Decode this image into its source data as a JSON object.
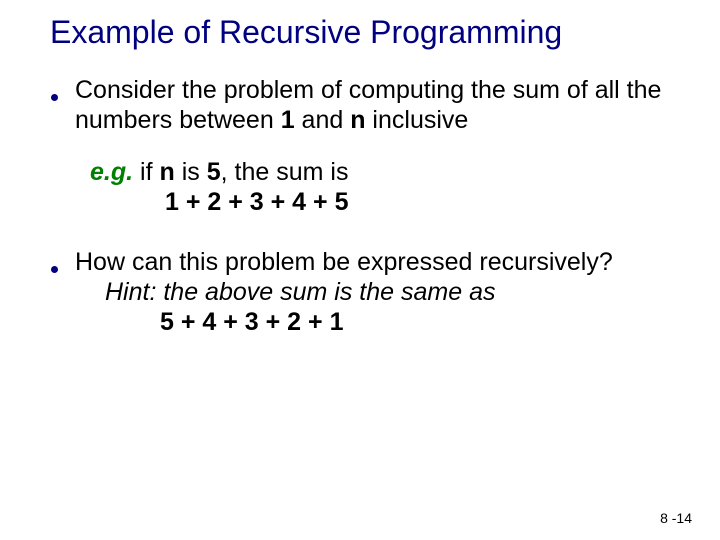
{
  "title": "Example of Recursive Programming",
  "bullet1": {
    "p1": "Consider the problem of computing the sum of all the numbers between ",
    "one": "1",
    "p2": " and ",
    "n": "n",
    "p3": " inclusive"
  },
  "example": {
    "eg": "e.g.",
    "p1": " if ",
    "n": "n",
    "p2": " is ",
    "five": "5",
    "p3": ", the sum is",
    "math": "1 + 2 + 3 + 4 + 5"
  },
  "bullet2": {
    "q": "How can this problem be expressed recursively?",
    "hint_label": "Hint:",
    "hint_text": " the above sum is the same as",
    "math": "5 + 4 + 3 + 2 + 1"
  },
  "footer": "8 -14"
}
